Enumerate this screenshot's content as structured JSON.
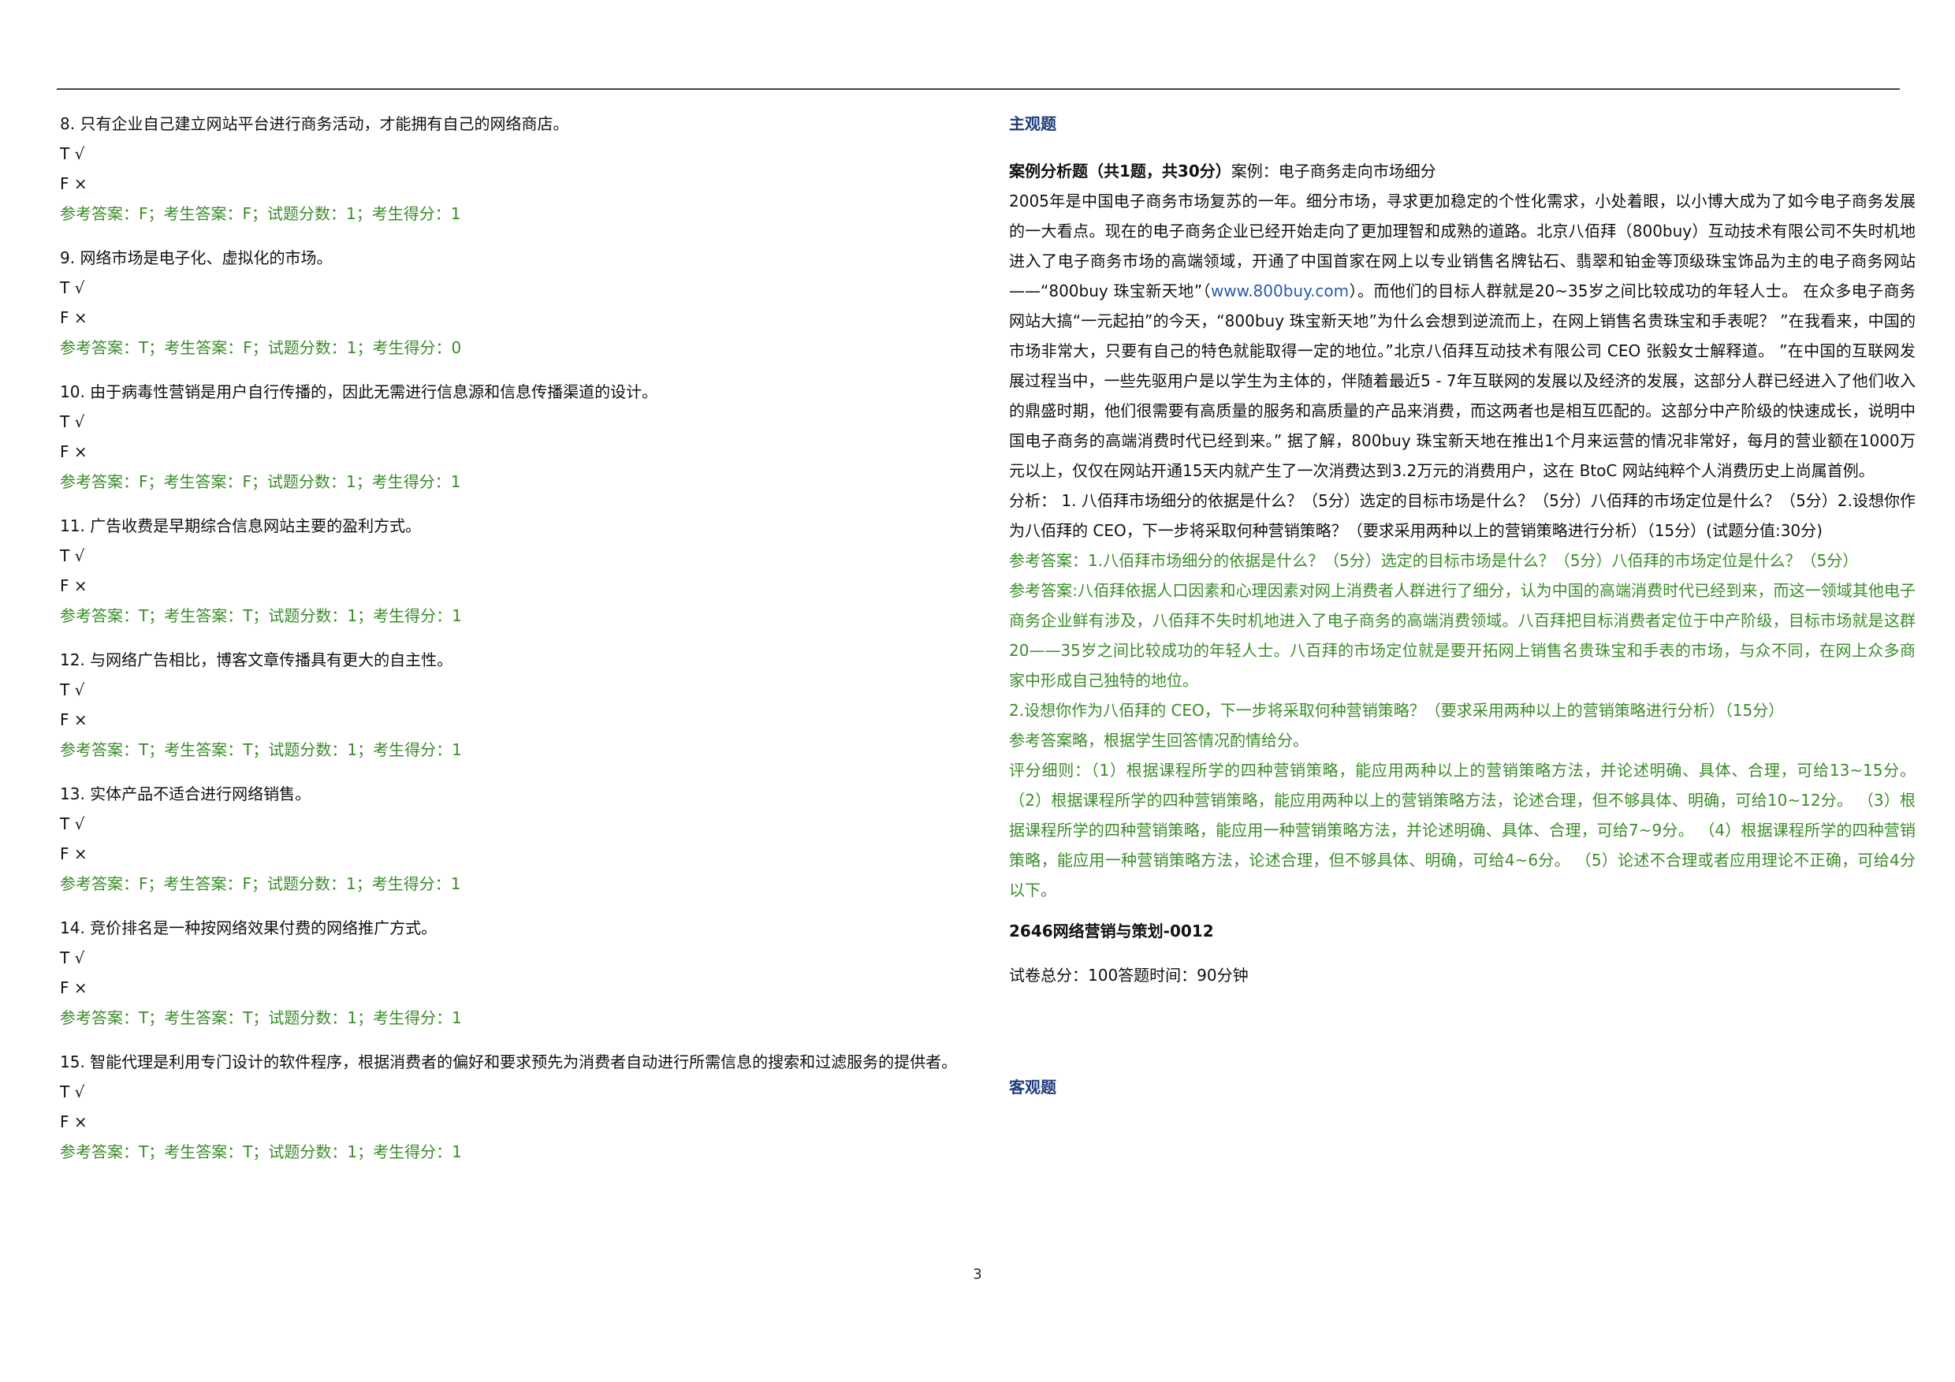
{
  "page_number": "3",
  "left_questions": [
    {
      "title": "8. 只有企业自己建立网站平台进行商务活动，才能拥有自己的网络商店。",
      "opt_t": "T √",
      "opt_f": "F ×",
      "answer": "参考答案：F；考生答案：F；试题分数：1；考生得分：1"
    },
    {
      "title": "9. 网络市场是电子化、虚拟化的市场。",
      "opt_t": "T √",
      "opt_f": "F ×",
      "answer": "参考答案：T；考生答案：F；试题分数：1；考生得分：0"
    },
    {
      "title": "10. 由于病毒性营销是用户自行传播的，因此无需进行信息源和信息传播渠道的设计。",
      "opt_t": "T √",
      "opt_f": "F ×",
      "answer": "参考答案：F；考生答案：F；试题分数：1；考生得分：1"
    },
    {
      "title": "11. 广告收费是早期综合信息网站主要的盈利方式。",
      "opt_t": "T √",
      "opt_f": "F ×",
      "answer": "参考答案：T；考生答案：T；试题分数：1；考生得分：1"
    },
    {
      "title": "12. 与网络广告相比，博客文章传播具有更大的自主性。",
      "opt_t": "T √",
      "opt_f": "F ×",
      "answer": "参考答案：T；考生答案：T；试题分数：1；考生得分：1"
    },
    {
      "title": "13. 实体产品不适合进行网络销售。",
      "opt_t": "T √",
      "opt_f": "F ×",
      "answer": "参考答案：F；考生答案：F；试题分数：1；考生得分：1"
    },
    {
      "title": "14. 竞价排名是一种按网络效果付费的网络推广方式。",
      "opt_t": "T √",
      "opt_f": "F ×",
      "answer": "参考答案：T；考生答案：T；试题分数：1；考生得分：1"
    },
    {
      "title": "15. 智能代理是利用专门设计的软件程序，根据消费者的偏好和要求预先为消费者自动进行所需信息的搜索和过滤服务的提供者。",
      "opt_t": "T √",
      "opt_f": "F ×",
      "answer": "参考答案：T；考生答案：T；试题分数：1；考生得分：1"
    }
  ],
  "right": {
    "section_subjective": "主观题",
    "case_label": "案例分析题（共1题，共30分）",
    "case_title": "案例：电子商务走向市场细分",
    "case_text_1": "2005年是中国电子商务市场复苏的一年。细分市场，寻求更加稳定的个性化需求，小处着眼，以小博大成为了如今电子商务发展的一大看点。现在的电子商务企业已经开始走向了更加理智和成熟的道路。北京八佰拜（800buy）互动技术有限公司不失时机地进入了电子商务市场的高端领域，开通了中国首家在网上以专业销售名牌钻石、翡翠和铂金等顶级珠宝饰品为主的电子商务网站——“800buy 珠宝新天地”（",
    "case_link": "www.800buy.com",
    "case_text_2": "）。而他们的目标人群就是20~35岁之间比较成功的年轻人士。 在众多电子商务网站大搞“一元起拍”的今天，“800buy 珠宝新天地”为什么会想到逆流而上，在网上销售名贵珠宝和手表呢？ ”在我看来，中国的市场非常大，只要有自己的特色就能取得一定的地位。”北京八佰拜互动技术有限公司 CEO 张毅女士解释道。 ”在中国的互联网发展过程当中，一些先驱用户是以学生为主体的，伴随着最近5 - 7年互联网的发展以及经济的发展，这部分人群已经进入了他们收入的鼎盛时期，他们很需要有高质量的服务和高质量的产品来消费，而这两者也是相互匹配的。这部分中产阶级的快速成长，说明中国电子商务的高端消费时代已经到来。” 据了解，800buy 珠宝新天地在推出1个月来运营的情况非常好，每月的营业额在1000万元以上，仅仅在网站开通15天内就产生了一次消费达到3.2万元的消费用户，这在 BtoC 网站纯粹个人消费历史上尚属首例。",
    "analysis": "分析： 1. 八佰拜市场细分的依据是什么？（5分）选定的目标市场是什么？（5分）八佰拜的市场定位是什么？（5分）2.设想你作为八佰拜的 CEO，下一步将采取何种营销策略？（要求采用两种以上的营销策略进行分析）（15分）(试题分值:30分)",
    "ref_1": "参考答案：1.八佰拜市场细分的依据是什么？（5分）选定的目标市场是什么？（5分）八佰拜的市场定位是什么？（5分）",
    "ref_2": "参考答案:八佰拜依据人口因素和心理因素对网上消费者人群进行了细分，认为中国的高端消费时代已经到来，而这一领域其他电子商务企业鲜有涉及，八佰拜不失时机地进入了电子商务的高端消费领域。八百拜把目标消费者定位于中产阶级，目标市场就是这群20——35岁之间比较成功的年轻人士。八百拜的市场定位就是要开拓网上销售名贵珠宝和手表的市场，与众不同，在网上众多商家中形成自己独特的地位。",
    "ref_3": "2.设想你作为八佰拜的 CEO，下一步将采取何种营销策略？（要求采用两种以上的营销策略进行分析）（15分）",
    "ref_4": "参考答案略，根据学生回答情况酌情给分。",
    "ref_5": "评分细则：（1）根据课程所学的四种营销策略，能应用两种以上的营销策略方法，并论述明确、具体、合理，可给13~15分。 （2）根据课程所学的四种营销策略，能应用两种以上的营销策略方法，论述合理，但不够具体、明确，可给10~12分。 （3）根据课程所学的四种营销策略，能应用一种营销策略方法，并论述明确、具体、合理，可给7~9分。 （4）根据课程所学的四种营销策略，能应用一种营销策略方法，论述合理，但不够具体、明确，可给4~6分。 （5）论述不合理或者应用理论不正确，可给4分以下。",
    "exam_title": "2646网络营销与策划-0012",
    "exam_info": "试卷总分：100答题时间：90分钟",
    "section_objective": "客观题"
  },
  "colors": {
    "answer_green": "#3b8c2a",
    "section_blue": "#1f3d7a",
    "link_blue": "#2a5aa8"
  }
}
